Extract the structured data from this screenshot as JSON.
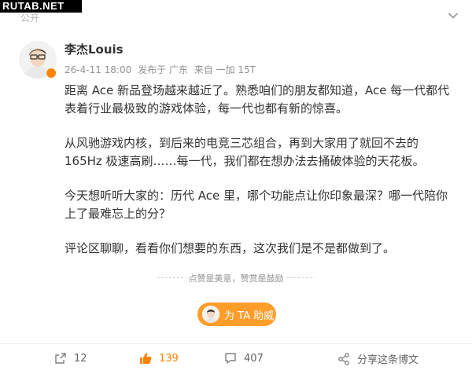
{
  "watermark": "RUTAB.NET",
  "post": {
    "visibility": "公开",
    "author": "李杰Louis",
    "time": "26-4-11 18:00",
    "location": "发布于 广东",
    "source": "来自 一加 15T",
    "paragraphs": [
      "距离 Ace 新品登场越来越近了。熟悉咱们的朋友都知道，Ace 每一代都代表着行业最极致的游戏体验，每一代也都有新的惊喜。",
      "从风驰游戏内核，到后来的电竞三芯组合，再到大家用了就回不去的 165Hz 极速高刷……每一代，我们都在想办法去捅破体验的天花板。",
      "今天想听听大家的：历代 Ace 里，哪个功能点让你印象最深？哪一代陪你上了最难忘上的分？",
      "评论区聊聊，看看你们想要的东西，这次我们是不是都做到了。"
    ]
  },
  "appreciation": {
    "divider_text": "点赞是美意，赞赏是鼓励",
    "support_label": "为 TA 助威"
  },
  "toolbar": {
    "share_count": "12",
    "like_count": "139",
    "comment_count": "407",
    "share_to_label": "分享这条博文"
  },
  "colors": {
    "accent": "#ff8200",
    "support_button": "#ff9d2a",
    "meta_text": "#939393"
  }
}
